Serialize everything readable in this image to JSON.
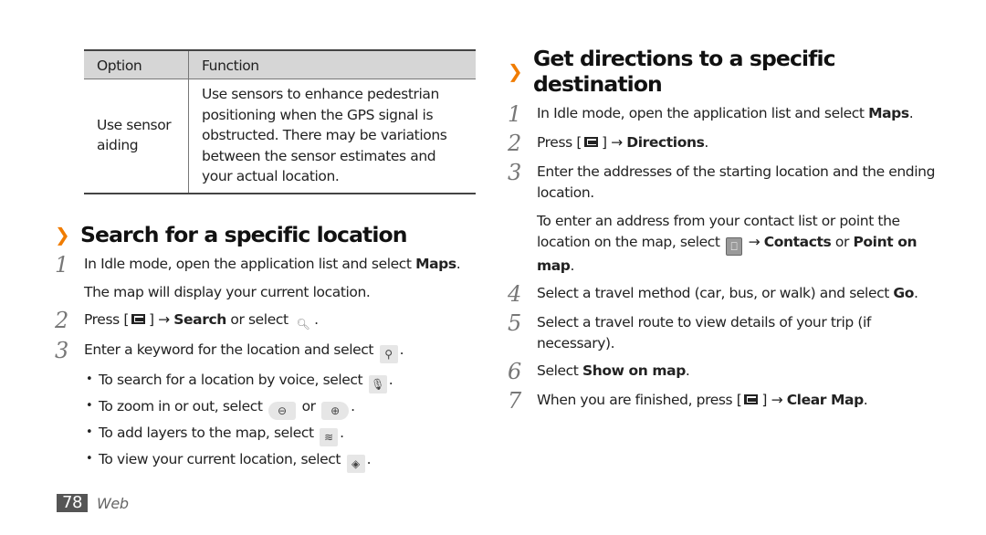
{
  "table": {
    "headers": [
      "Option",
      "Function"
    ],
    "rows": [
      {
        "option": "Use sensor aiding",
        "function": "Use sensors to enhance pedestrian positioning when the GPS signal is obstructed. There may be variations between the sensor estimates and your actual location."
      }
    ]
  },
  "search_section": {
    "title": "Search for a specific location",
    "steps": [
      {
        "num": "1",
        "text": "In Idle mode, open the application list and select ",
        "bold": "Maps",
        "after": ".",
        "note": "The map will display your current location."
      },
      {
        "num": "2",
        "pre": "Press [",
        "post": "] → ",
        "bold": "Search",
        "after": " or select ",
        "end": "."
      },
      {
        "num": "3",
        "text": "Enter a keyword for the location and select ",
        "end": "."
      }
    ],
    "bullets": [
      {
        "text": "To search for a location by voice, select ",
        "icon": "microphone-icon",
        "end": "."
      },
      {
        "text": "To zoom in or out, select ",
        "mid": " or ",
        "icon": "zoom-out-icon",
        "icon2": "zoom-in-icon",
        "end": "."
      },
      {
        "text": "To add layers to the map, select ",
        "icon": "layers-icon",
        "end": "."
      },
      {
        "text": "To view your current location, select ",
        "icon": "my-location-icon",
        "end": "."
      }
    ]
  },
  "directions_section": {
    "title": "Get directions to a specific destination",
    "steps": [
      {
        "num": "1",
        "text": "In Idle mode, open the application list and select ",
        "bold": "Maps",
        "after": "."
      },
      {
        "num": "2",
        "pre": "Press [",
        "post": "] → ",
        "bold": "Directions",
        "after": "."
      },
      {
        "num": "3",
        "text": "Enter the addresses of the starting location and the ending location.",
        "note_pre": "To enter an address from your contact list or point the location on the map, select ",
        "note_arrow": " → ",
        "note_bold1": "Contacts",
        "note_or": " or ",
        "note_bold2": "Point on map",
        "note_end": "."
      },
      {
        "num": "4",
        "text": "Select a travel method (car, bus, or walk) and select ",
        "bold": "Go",
        "after": "."
      },
      {
        "num": "5",
        "text": "Select a travel route to view details of your trip (if necessary)."
      },
      {
        "num": "6",
        "text": "Select ",
        "bold": "Show on map",
        "after": "."
      },
      {
        "num": "7",
        "pre": "When you are finished, press [",
        "post": "] → ",
        "bold": "Clear Map",
        "after": "."
      }
    ]
  },
  "footer": {
    "page": "78",
    "section": "Web"
  },
  "colors": {
    "accent": "#f07c00",
    "table_header": "#d6d6d6",
    "page_badge": "#555555"
  }
}
